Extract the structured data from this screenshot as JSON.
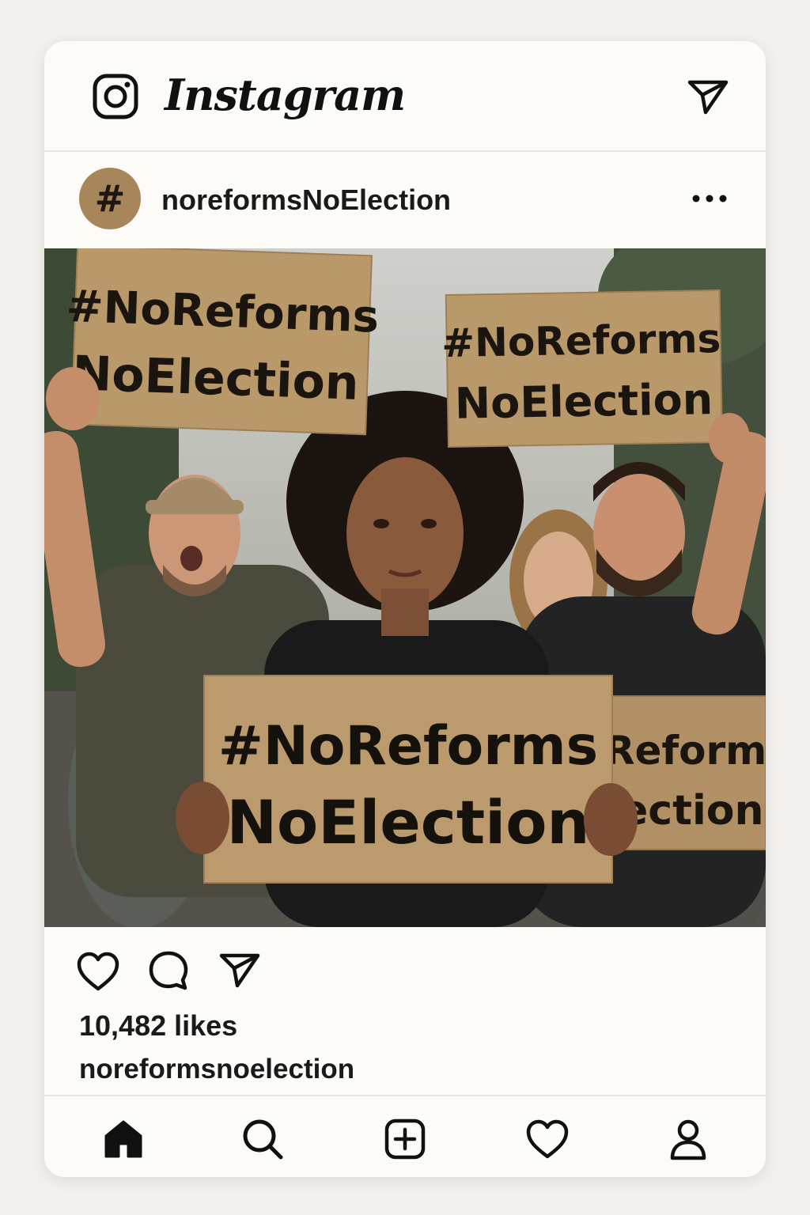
{
  "app": {
    "brand": "Instagram",
    "icons": {
      "logo": "instagram-camera-icon",
      "direct": "paper-plane-icon"
    }
  },
  "post": {
    "avatar_glyph": "#",
    "username": "noreformsNoElection",
    "more_icon": "more-horizontal-icon",
    "image": {
      "signs": [
        {
          "line1": "#NoReforms",
          "line2": "NoElection"
        },
        {
          "line1": "#NoReforms",
          "line2": "NoElection"
        },
        {
          "line1": "#NoReforms",
          "line2": "NoElection"
        },
        {
          "line1": "Reforms",
          "line2": "ection"
        }
      ]
    },
    "actions": {
      "like": "heart-icon",
      "comment": "comment-icon",
      "share": "paper-plane-icon"
    },
    "likes_text": "10,482 likes",
    "caption_username": "noreformsnoelection"
  },
  "bottom_nav": [
    {
      "name": "home",
      "icon": "home-icon",
      "active": true
    },
    {
      "name": "search",
      "icon": "search-icon",
      "active": false
    },
    {
      "name": "create",
      "icon": "plus-square-icon",
      "active": false
    },
    {
      "name": "activity",
      "icon": "heart-icon",
      "active": false
    },
    {
      "name": "profile",
      "icon": "person-icon",
      "active": false
    }
  ],
  "colors": {
    "background": "#f3f1ee",
    "card": "#fdfbf8",
    "cardboard": "#b9986a",
    "text": "#1b1b1b",
    "avatar": "#a8865b"
  }
}
